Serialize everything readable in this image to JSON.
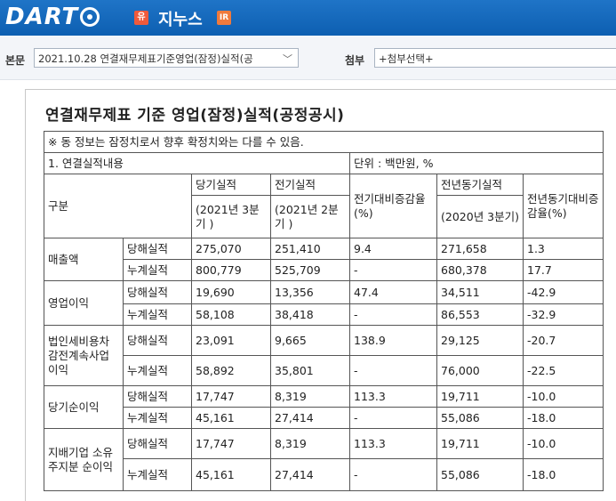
{
  "header": {
    "logo": "DART",
    "badge_left": "유",
    "brand": "지누스",
    "badge_right": "IR"
  },
  "toolbar": {
    "body_label": "본문",
    "body_value": "2021.10.28 연결재무제표기준영업(잠정)실적(공",
    "attach_label": "첨부",
    "attach_value": "+첨부선택+"
  },
  "document": {
    "title": "연결재무제표 기준 영업(잠정)실적(공정공시)",
    "notice": "※ 동 정보는 잠정치로서 향후 확정치와는 다를 수 있음.",
    "section": "1. 연결실적내용",
    "unit": "단위 : 백만원, %",
    "headers": {
      "category": "구분",
      "current": "당기실적",
      "current_period": "(2021년 3분기 )",
      "previous": "전기실적",
      "previous_period": "(2021년 2분기 )",
      "qoq": "전기대비증감율(%)",
      "yoy_base": "전년동기실적",
      "yoy_period": "(2020년 3분기)",
      "yoy": "전년동기대비증감율(%)"
    },
    "rows": [
      {
        "item": "매출액",
        "sub": [
          {
            "type": "당해실적",
            "cur": "275,070",
            "prev": "251,410",
            "qoq": "9.4",
            "yoyv": "271,658",
            "yoy": "1.3"
          },
          {
            "type": "누계실적",
            "cur": "800,779",
            "prev": "525,709",
            "qoq": "-",
            "yoyv": "680,378",
            "yoy": "17.7"
          }
        ]
      },
      {
        "item": "영업이익",
        "sub": [
          {
            "type": "당해실적",
            "cur": "19,690",
            "prev": "13,356",
            "qoq": "47.4",
            "yoyv": "34,511",
            "yoy": "-42.9"
          },
          {
            "type": "누계실적",
            "cur": "58,108",
            "prev": "38,418",
            "qoq": "-",
            "yoyv": "86,553",
            "yoy": "-32.9"
          }
        ]
      },
      {
        "item": "법인세비용차감전계속사업이익",
        "sub": [
          {
            "type": "당해실적",
            "cur": "23,091",
            "prev": "9,665",
            "qoq": "138.9",
            "yoyv": "29,125",
            "yoy": "-20.7"
          },
          {
            "type": "누계실적",
            "cur": "58,892",
            "prev": "35,801",
            "qoq": "-",
            "yoyv": "76,000",
            "yoy": "-22.5"
          }
        ]
      },
      {
        "item": "당기순이익",
        "sub": [
          {
            "type": "당해실적",
            "cur": "17,747",
            "prev": "8,319",
            "qoq": "113.3",
            "yoyv": "19,711",
            "yoy": "-10.0"
          },
          {
            "type": "누계실적",
            "cur": "45,161",
            "prev": "27,414",
            "qoq": "-",
            "yoyv": "55,086",
            "yoy": "-18.0"
          }
        ]
      },
      {
        "item": "지배기업 소유주지분 순이익",
        "sub": [
          {
            "type": "당해실적",
            "cur": "17,747",
            "prev": "8,319",
            "qoq": "113.3",
            "yoyv": "19,711",
            "yoy": "-10.0"
          },
          {
            "type": "누계실적",
            "cur": "45,161",
            "prev": "27,414",
            "qoq": "-",
            "yoyv": "55,086",
            "yoy": "-18.0"
          }
        ]
      }
    ]
  }
}
